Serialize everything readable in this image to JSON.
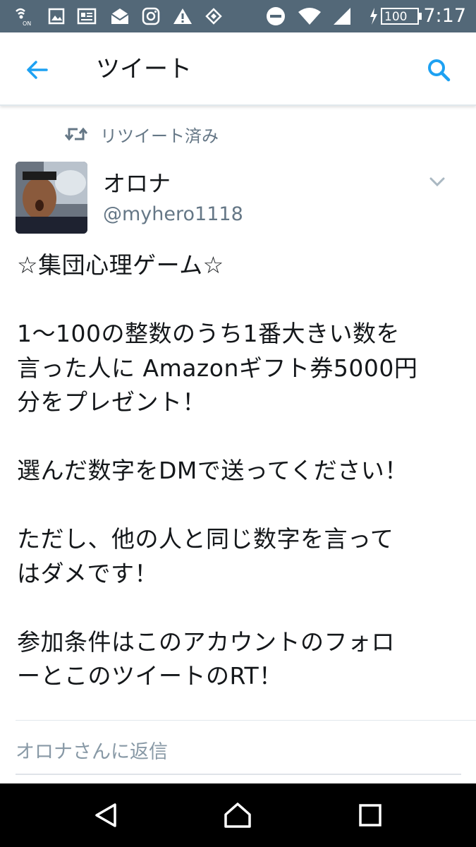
{
  "status_bar": {
    "time": "7:17",
    "battery": "100",
    "icons": [
      "nfc-on-icon",
      "gallery-icon",
      "news-icon",
      "mail-icon",
      "instagram-icon",
      "warning-icon",
      "shopping-icon",
      "do-not-disturb-icon",
      "wifi-icon",
      "signal-icon",
      "battery-charging-icon"
    ]
  },
  "app_bar": {
    "title": "ツイート",
    "back_icon": "arrow-left-icon",
    "search_icon": "search-icon",
    "accent_color": "#1da1f2"
  },
  "tweet": {
    "retweet_label": "リツイート済み",
    "author_name": "オロナ",
    "author_handle": "@myhero1118",
    "lines": [
      "☆集団心理ゲーム☆",
      "",
      "1〜100の整数のうち1番大きい数を",
      "言った人に Amazonギフト券5000円",
      "分をプレゼント！",
      "",
      "選んだ数字をDMで送ってください！",
      "",
      "ただし、他の人と同じ数字を言って",
      "はダメです！",
      "",
      "参加条件はこのアカウントのフォロ",
      "ーとこのツイートのRT！"
    ]
  },
  "reply": {
    "placeholder": "オロナさんに返信"
  },
  "nav_bar": {
    "icons": [
      "back-triangle-icon",
      "home-icon",
      "recents-icon"
    ]
  }
}
